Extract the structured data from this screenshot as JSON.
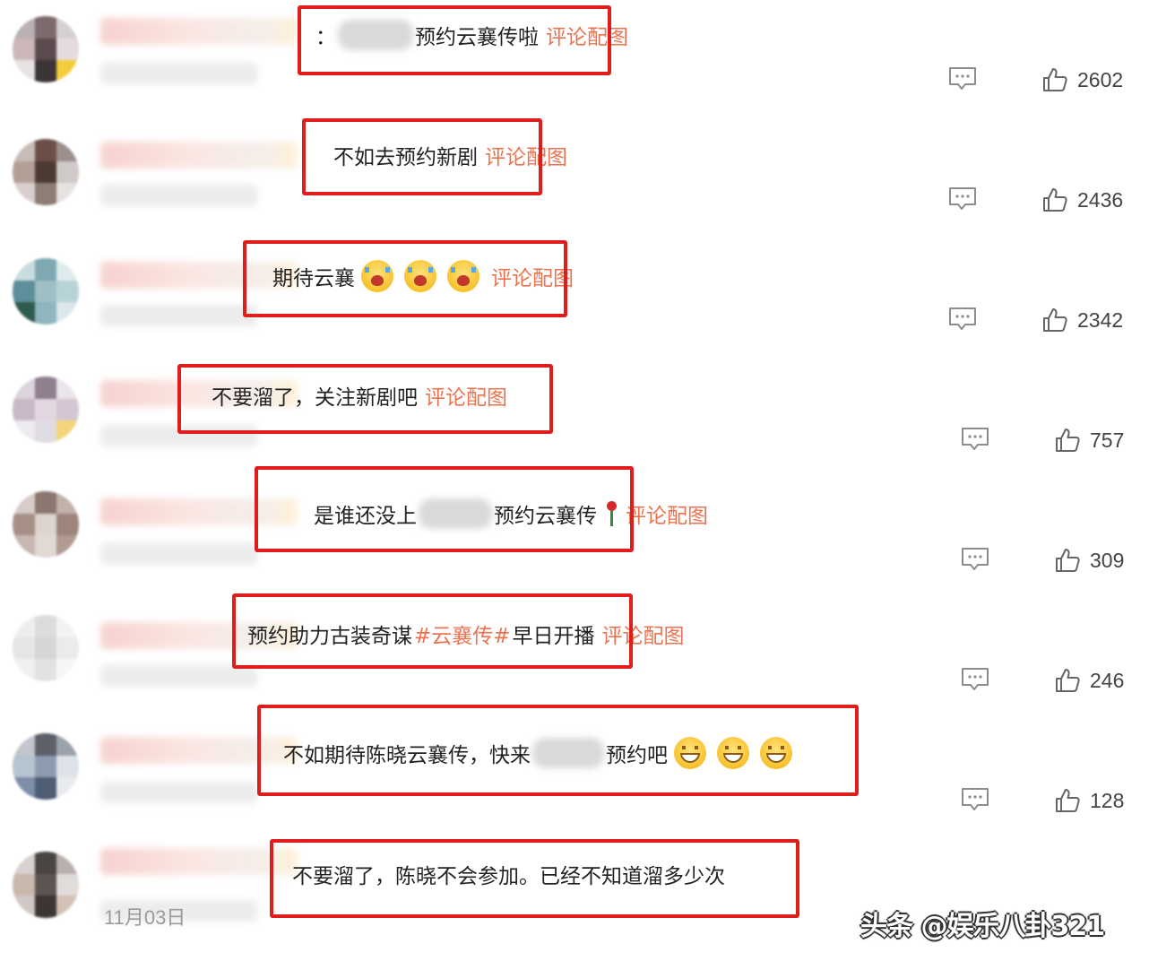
{
  "comments": [
    {
      "segments": [
        {
          "kind": "text",
          "value": "："
        },
        {
          "kind": "mask",
          "width": 84
        },
        {
          "kind": "text",
          "value": "预约云襄传啦"
        },
        {
          "kind": "link",
          "value": "评论配图"
        }
      ],
      "likes": "2602",
      "avatar_colors": [
        "#b9b1b3",
        "#7c6a6d",
        "#d7d0d2",
        "#cdb7ba",
        "#5b4b4f",
        "#e4dbdd",
        "#e7e2e3",
        "#3c3437",
        "#f3cd3b"
      ]
    },
    {
      "segments": [
        {
          "kind": "text",
          "value": "不如去预约新剧"
        },
        {
          "kind": "link",
          "value": "评论配图"
        }
      ],
      "likes": "2436",
      "avatar_colors": [
        "#c7bcb8",
        "#6c5048",
        "#9b8f8c",
        "#b49f97",
        "#4c3a33",
        "#cfc9c7",
        "#d9d0ce",
        "#8e7c76",
        "#e6e2e1"
      ]
    },
    {
      "segments": [
        {
          "kind": "text",
          "value": "期待云襄"
        },
        {
          "kind": "emoji",
          "type": "cry"
        },
        {
          "kind": "emoji",
          "type": "cry"
        },
        {
          "kind": "emoji",
          "type": "cry"
        },
        {
          "kind": "link",
          "value": "评论配图"
        }
      ],
      "likes": "2342",
      "avatar_colors": [
        "#c9dde0",
        "#7fa8b3",
        "#e0ebee",
        "#5e8e9b",
        "#9fbfc6",
        "#b8d3d7",
        "#2f5b4d",
        "#8fb5bf",
        "#dbe7ea"
      ]
    },
    {
      "segments": [
        {
          "kind": "text",
          "value": "不要溜了，关注新剧吧"
        },
        {
          "kind": "link",
          "value": "评论配图"
        }
      ],
      "likes": "757",
      "time_text": "",
      "avatar_colors": [
        "#dcd3dc",
        "#8f7f8f",
        "#eae5ea",
        "#c9b8c6",
        "#e3d8e2",
        "#d4c7d3",
        "#ecebf0",
        "#e1dbe4",
        "#f5d47a"
      ]
    },
    {
      "segments": [
        {
          "kind": "text",
          "value": "是谁还没上"
        },
        {
          "kind": "mask",
          "width": 82
        },
        {
          "kind": "text",
          "value": "预约云襄传"
        },
        {
          "kind": "rose"
        },
        {
          "kind": "link",
          "value": "评论配图"
        }
      ],
      "likes": "309",
      "avatar_colors": [
        "#d6ccc8",
        "#8a7770",
        "#c1b1ab",
        "#a68f86",
        "#ddd3cf",
        "#9d857c",
        "#c8b7b0",
        "#e2d9d5",
        "#b09a91"
      ]
    },
    {
      "segments": [
        {
          "kind": "text",
          "value": "预约助力古装奇谋"
        },
        {
          "kind": "tag",
          "value": "#云襄传#"
        },
        {
          "kind": "text",
          "value": "早日开播"
        },
        {
          "kind": "link",
          "value": "评论配图"
        }
      ],
      "likes": "246",
      "avatar_colors": [
        "#eeeeee",
        "#dcdcdc",
        "#f3f3f3",
        "#e5e5e5",
        "#d6d6d6",
        "#ebebeb",
        "#f0f0f0",
        "#e2e2e2",
        "#f7f7f7"
      ]
    },
    {
      "segments": [
        {
          "kind": "text",
          "value": "不如期待陈晓云襄传，快来"
        },
        {
          "kind": "mask",
          "width": 80
        },
        {
          "kind": "text",
          "value": "预约吧"
        },
        {
          "kind": "emoji",
          "type": "grin"
        },
        {
          "kind": "emoji",
          "type": "grin"
        },
        {
          "kind": "emoji",
          "type": "grin"
        }
      ],
      "likes": "128",
      "avatar_colors": [
        "#c2c6cc",
        "#5d6068",
        "#9aa1ab",
        "#b6c3d1",
        "#8d9bb0",
        "#dfe3e8",
        "#7c8ea8",
        "#4f5e74",
        "#e8eaee"
      ]
    },
    {
      "segments": [
        {
          "kind": "text",
          "value": "不要溜了，陈晓不会参加。已经不知道溜多少次"
        }
      ],
      "likes": "",
      "time_text": "11月03日",
      "avatar_colors": [
        "#d7d2cf",
        "#4a4443",
        "#b8b0ad",
        "#c9b9ad",
        "#5b5452",
        "#e0dcd9",
        "#cfc8c4",
        "#3b3534",
        "#d3c1b5"
      ]
    }
  ],
  "watermark": "头条 @娱乐八卦321",
  "colors": {
    "highlight_box": "#e01d1d",
    "link": "#eb7350"
  }
}
